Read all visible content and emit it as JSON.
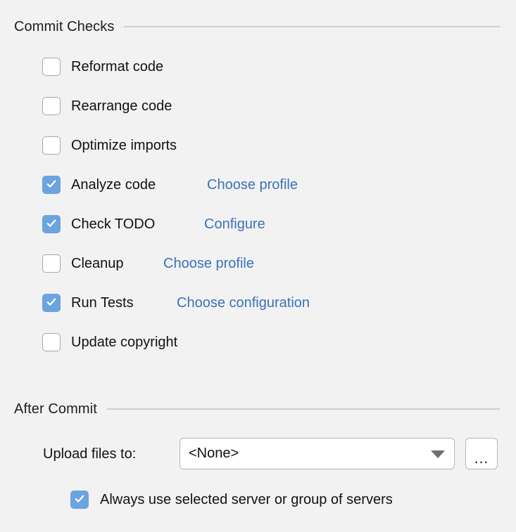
{
  "colors": {
    "background": "#f2f2f2",
    "checkbox_checked": "#6ba4de",
    "link": "#3a72b8",
    "text": "#111111",
    "rule": "#cfcfcf",
    "field_border": "#b7b7b7"
  },
  "commit_checks": {
    "title": "Commit Checks",
    "items": [
      {
        "label": "Reformat code",
        "checked": false,
        "link": ""
      },
      {
        "label": "Rearrange code",
        "checked": false,
        "link": ""
      },
      {
        "label": "Optimize imports",
        "checked": false,
        "link": ""
      },
      {
        "label": "Analyze code",
        "checked": true,
        "link": "Choose profile"
      },
      {
        "label": "Check TODO",
        "checked": true,
        "link": "Configure"
      },
      {
        "label": "Cleanup",
        "checked": false,
        "link": "Choose profile"
      },
      {
        "label": "Run Tests",
        "checked": true,
        "link": "Choose configuration"
      },
      {
        "label": "Update copyright",
        "checked": false,
        "link": ""
      }
    ]
  },
  "after_commit": {
    "title": "After Commit",
    "upload_label": "Upload files to:",
    "upload_value": "<None>",
    "upload_options": [
      "<None>"
    ],
    "browse_label": "...",
    "always_use": {
      "label": "Always use selected server or group of servers",
      "checked": true
    }
  }
}
